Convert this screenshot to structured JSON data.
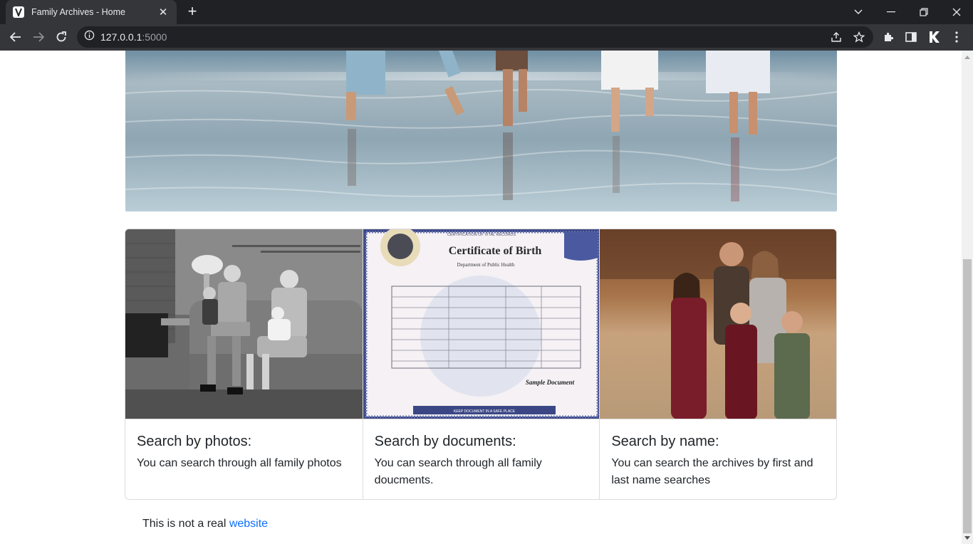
{
  "browser": {
    "tab_title": "Family Archives - Home",
    "url_host": "127.0.0.1",
    "url_port": ":5000"
  },
  "hero": {
    "image": "family walking in shallow beach water"
  },
  "cards": [
    {
      "title": "Search by photos:",
      "text": "You can search through all family photos",
      "image": "black-and-white vintage family photo on a sofa"
    },
    {
      "title": "Search by documents:",
      "text": "You can search through all family doucments.",
      "image": "certificate of birth document",
      "doc": {
        "header": "CERTIFICATION OF VITAL RECORDS",
        "title": "Certificate of Birth",
        "dept": "Department of Public Health",
        "sample": "Sample Document",
        "footer": "KEEP DOCUMENT IN A SAFE PLACE"
      }
    },
    {
      "title": "Search by name:",
      "text": "You can search the archives by first and last name searches",
      "image": "modern family portrait in an autumn field"
    }
  ],
  "footer": {
    "text": "This is not a real ",
    "link": "website"
  },
  "colors": {
    "link": "#0d6efd",
    "chrome_dark": "#202124",
    "chrome_toolbar": "#35363a"
  }
}
